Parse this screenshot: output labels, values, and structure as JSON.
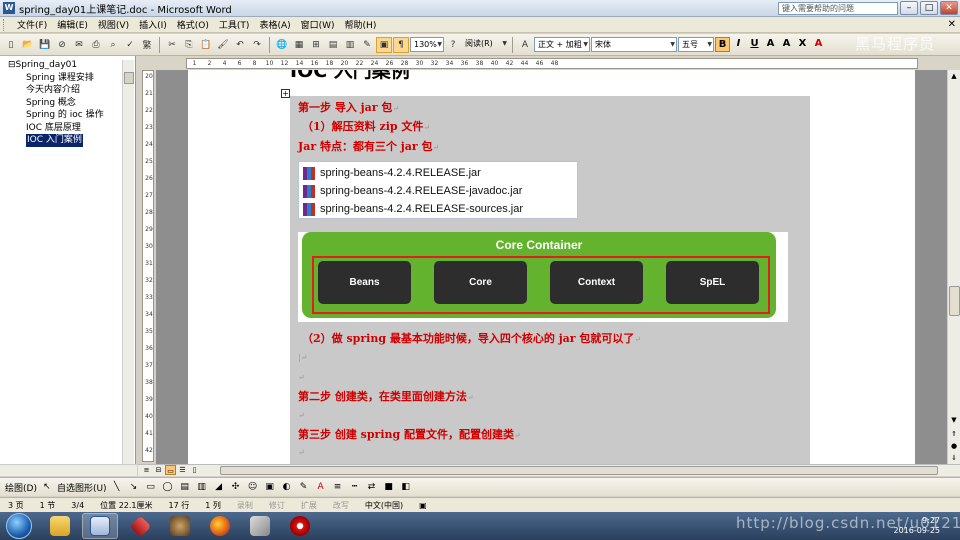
{
  "window": {
    "title": "spring_day01上课笔记.doc - Microsoft Word",
    "help_placeholder": "键入需要帮助的问题"
  },
  "menu": [
    "文件(F)",
    "编辑(E)",
    "视图(V)",
    "插入(I)",
    "格式(O)",
    "工具(T)",
    "表格(A)",
    "窗口(W)",
    "帮助(H)"
  ],
  "toolbar": {
    "zoom": "130%",
    "read_label": "阅读(R)",
    "style": "正文 + 加粗",
    "font": "宋体",
    "size": "五号",
    "watermark": "黑马程序员"
  },
  "docmap": {
    "root": "Spring_day01",
    "items": [
      "Spring 课程安排",
      "今天内容介绍",
      "Spring 概念",
      "Spring 的 ioc 操作",
      "IOC 底层原理",
      "IOC 入门案例"
    ],
    "selected_index": 5
  },
  "ruler": {
    "h_ticks": [
      "1",
      "2",
      "4",
      "6",
      "8",
      "10",
      "12",
      "14",
      "16",
      "18",
      "20",
      "22",
      "24",
      "26",
      "28",
      "30",
      "32",
      "34",
      "36",
      "38",
      "40",
      "42",
      "44",
      "46",
      "48"
    ],
    "v_ticks": [
      "20",
      "21",
      "22",
      "23",
      "24",
      "25",
      "26",
      "27",
      "28",
      "29",
      "30",
      "31",
      "32",
      "33",
      "34",
      "35",
      "36",
      "37",
      "38",
      "39",
      "40",
      "41",
      "42"
    ]
  },
  "document": {
    "heading": "IOC 入门案例",
    "lines": [
      "第一步  导入 jar 包",
      "（1）解压资料 zip 文件",
      "Jar 特点：都有三个 jar 包",
      "（2）做 spring 最基本功能时候，导入四个核心的 jar 包就可以了",
      "第二步  创建类，在类里面创建方法",
      "第三步  创建 spring 配置文件，配置创建类"
    ],
    "jars": [
      "spring-beans-4.2.4.RELEASE.jar",
      "spring-beans-4.2.4.RELEASE-javadoc.jar",
      "spring-beans-4.2.4.RELEASE-sources.jar"
    ],
    "core_container": {
      "title": "Core Container",
      "modules": [
        "Beans",
        "Core",
        "Context",
        "SpEL"
      ]
    }
  },
  "drawbar": {
    "draw_label": "绘图(D)",
    "autoshape_label": "自选图形(U)"
  },
  "status": {
    "page": "3 页",
    "section": "1 节",
    "pages": "3/4",
    "position": "位置 22.1厘米",
    "line": "17 行",
    "column": "1 列",
    "rec": "录制",
    "trk": "修订",
    "ext": "扩展",
    "ovr": "改写",
    "lang": "中文(中国)"
  },
  "taskbar": {
    "time": "9:27",
    "date": "2016-09-25",
    "watermark": "http://blog.csdn.net/u012124..."
  },
  "colors": {
    "heading_red": "#d00000",
    "core_green": "#63b32e",
    "module_dark": "#2d2d2d",
    "highlight": "#0a246a"
  }
}
